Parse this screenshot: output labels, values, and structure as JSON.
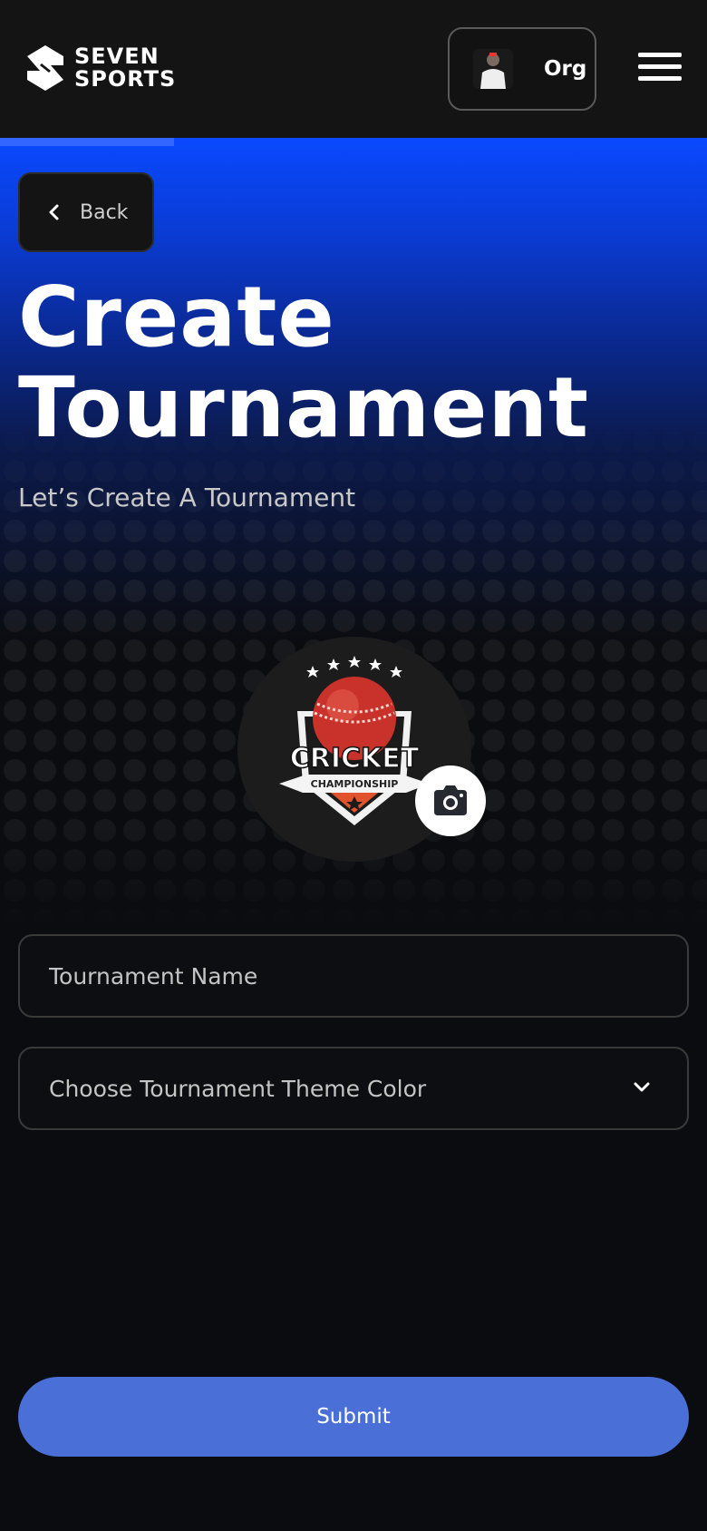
{
  "brand": {
    "line1": "SEVEN",
    "line2": "SPORTS"
  },
  "header": {
    "org_label": "Org",
    "menu_icon": "hamburger-icon",
    "avatar": "user-avatar"
  },
  "nav": {
    "back_label": "Back",
    "back_icon": "chevron-left-icon"
  },
  "page": {
    "title_line1": "Create",
    "title_line2": "Tournament",
    "subtitle": "Let’s Create A Tournament"
  },
  "logo_upload": {
    "badge_text": "CRICKET",
    "badge_ribbon": "CHAMPIONSHIP",
    "camera_icon": "camera-icon"
  },
  "form": {
    "name_placeholder": "Tournament Name",
    "name_value": "",
    "theme_placeholder": "Choose Tournament Theme Color",
    "submit_label": "Submit"
  },
  "colors": {
    "accent": "#0a49ff",
    "submit": "#4a6fd6",
    "background": "#0b0c0f",
    "header": "#141414"
  }
}
